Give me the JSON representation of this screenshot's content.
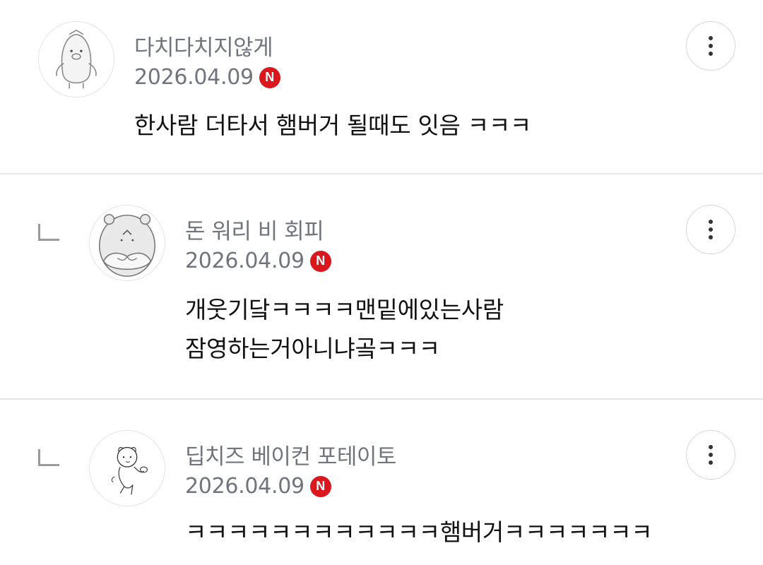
{
  "comments": [
    {
      "nickname": "다치다치지않게",
      "date": "2026.04.09",
      "badge": "N",
      "text": "한사람 더타서 햄버거 될때도 잇음 ㅋㅋㅋ",
      "avatar_icon": "penguin-avatar-icon"
    },
    {
      "nickname": "돈 워리 비 회피",
      "date": "2026.04.09",
      "badge": "N",
      "text": "개웃기닼ㅋㅋㅋㅋ맨밑에있는사람\n잠영하는거아니냐곸ㅋㅋㅋ",
      "avatar_icon": "hamster-avatar-icon"
    },
    {
      "nickname": "딥치즈 베이컨 포테이토",
      "date": "2026.04.09",
      "badge": "N",
      "text": "ㅋㅋㅋㅋㅋㅋㅋㅋㅋㅋㅋㅋ햄버거ㅋㅋㅋㅋㅋㅋㅋ",
      "avatar_icon": "sketch-character-avatar-icon"
    }
  ],
  "colors": {
    "badge": "#d9171d",
    "meta_text": "#70757d",
    "body_text": "#111111",
    "divider": "#e6e6e6"
  }
}
